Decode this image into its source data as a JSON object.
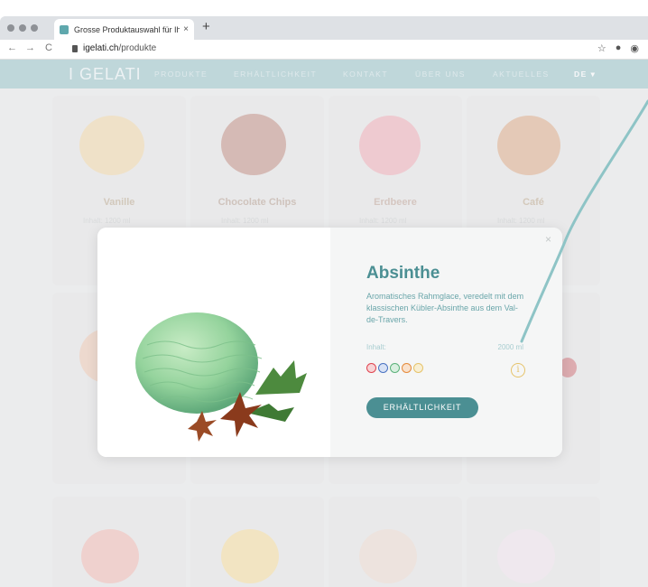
{
  "browser": {
    "tab_title": "Grosse Produktauswahl für Ihr",
    "tab_close": "×",
    "new_tab": "+",
    "back": "←",
    "forward": "→",
    "reload": "C",
    "url_host": "igelati.ch",
    "url_path": "/produkte",
    "star": "☆",
    "profile": "●",
    "extension": "◉"
  },
  "site": {
    "logo": "I GELATI",
    "nav": {
      "produkte": "PRODUKTE",
      "erhaeltlichkeit": "ERHÄLTLICHKEIT",
      "kontakt": "KONTAKT",
      "ueber_uns": "ÜBER UNS",
      "aktuelles": "AKTUELLES",
      "language": "DE ▾"
    }
  },
  "products_row1": [
    {
      "name": "Vanille",
      "inhalt": "Inhalt: 1200 ml"
    },
    {
      "name": "Chocolate Chips",
      "inhalt": "Inhalt: 1200 ml"
    },
    {
      "name": "Erdbeere",
      "inhalt": "Inhalt: 1200 ml"
    },
    {
      "name": "Café",
      "inhalt": "Inhalt: 1200 ml"
    }
  ],
  "modal": {
    "close": "×",
    "title": "Absinthe",
    "description": "Aromatisches Rahmglace, veredelt mit dem klassischen Kübler-Absinthe aus dem Val-de-Travers.",
    "inhalt_label": "Inhalt:",
    "inhalt_value": "2000 ml",
    "info_icon": "i",
    "button": "ERHÄLTLICHKEIT"
  },
  "colors": {
    "teal": "#4b8f93",
    "nav_bg": "#a8ccd0",
    "badge_red": "#e0434f",
    "badge_blue": "#4a73c2",
    "badge_green": "#5bb27a",
    "badge_orange": "#e58a3a",
    "badge_yellow": "#e6c36a"
  }
}
